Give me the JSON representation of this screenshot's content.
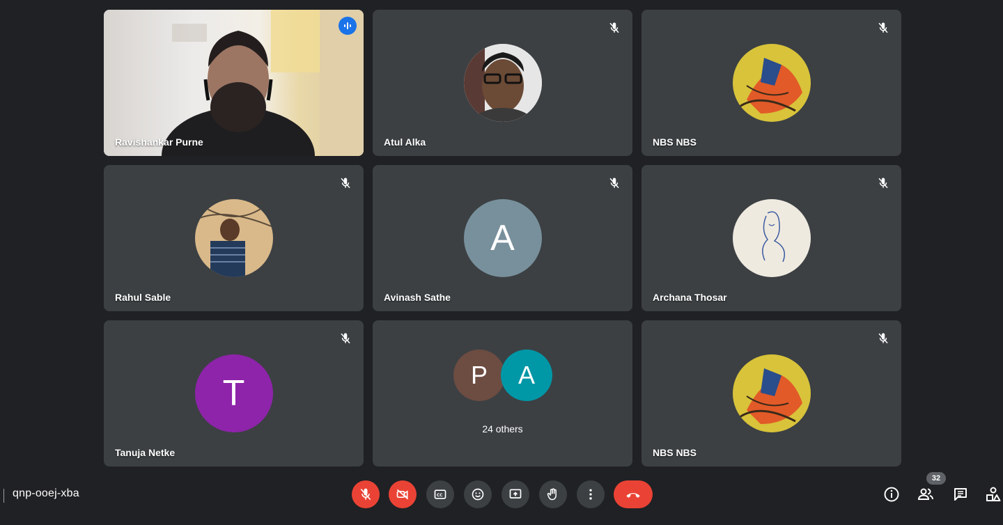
{
  "meeting": {
    "code": "qnp-ooej-xba",
    "participant_count": "32"
  },
  "participants": [
    {
      "name": "Ravishankar Purne",
      "muted": false,
      "speaking": true,
      "type": "video"
    },
    {
      "name": "Atul Alka",
      "muted": true,
      "type": "photo"
    },
    {
      "name": "NBS NBS",
      "muted": true,
      "type": "photo"
    },
    {
      "name": "Rahul Sable",
      "muted": true,
      "type": "photo"
    },
    {
      "name": "Avinash Sathe",
      "muted": true,
      "type": "initial",
      "initial": "A",
      "color": "#78909c"
    },
    {
      "name": "Archana Thosar",
      "muted": true,
      "type": "photo"
    },
    {
      "name": "Tanuja Netke",
      "muted": true,
      "type": "initial",
      "initial": "T",
      "color": "#8e24aa"
    },
    {
      "type": "group",
      "initials": [
        "P",
        "A"
      ],
      "colors": [
        "#6d4c41",
        "#0097a7"
      ],
      "label": "24 others"
    },
    {
      "name": "NBS NBS",
      "muted": true,
      "type": "photo"
    }
  ],
  "controls": [
    {
      "icon": "mic-off-icon",
      "state": "off",
      "color": "#ea4335"
    },
    {
      "icon": "camera-off-icon",
      "state": "off",
      "color": "#ea4335"
    },
    {
      "icon": "captions-icon"
    },
    {
      "icon": "emoji-icon"
    },
    {
      "icon": "present-screen-icon"
    },
    {
      "icon": "raise-hand-icon"
    },
    {
      "icon": "more-options-icon"
    },
    {
      "icon": "end-call-icon",
      "color": "#ea4335"
    }
  ],
  "right_controls": [
    "info-icon",
    "people-icon",
    "chat-icon",
    "activities-icon"
  ],
  "colors": {
    "background": "#202124",
    "tile": "#3c4043",
    "accent": "#8ab4f8",
    "danger": "#ea4335"
  }
}
